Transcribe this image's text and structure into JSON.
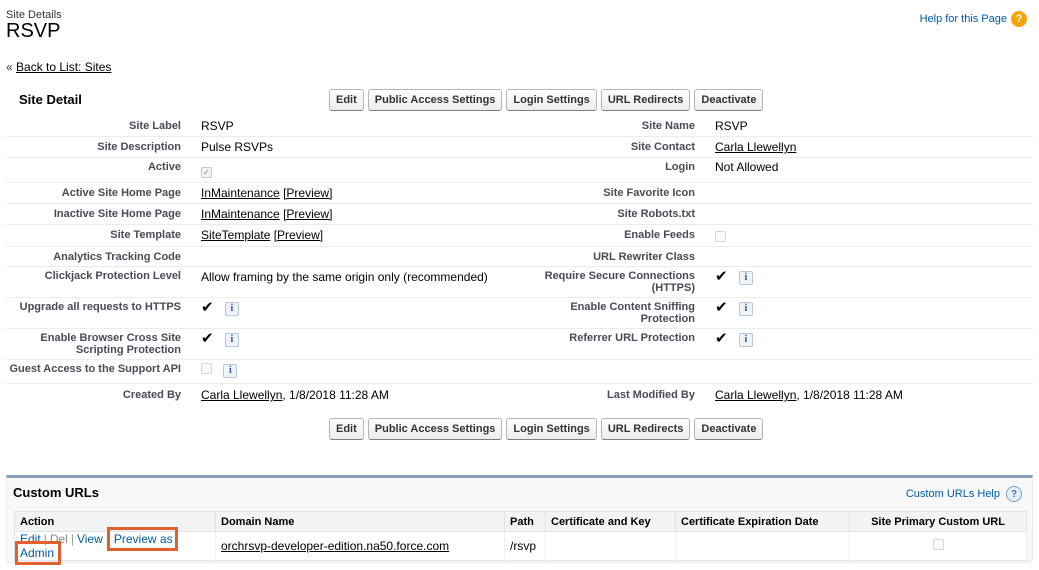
{
  "header": {
    "subtitle": "Site Details",
    "title": "RSVP",
    "help_label": "Help for this Page",
    "help_icon": "question-icon",
    "back_prefix": "«",
    "back_label": "Back to List: Sites"
  },
  "detail": {
    "section_title": "Site Detail",
    "buttons": [
      "Edit",
      "Public Access Settings",
      "Login Settings",
      "URL Redirects",
      "Deactivate"
    ],
    "rows": {
      "site_label": {
        "label": "Site Label",
        "value": "RSVP"
      },
      "site_name": {
        "label": "Site Name",
        "value": "RSVP"
      },
      "site_description": {
        "label": "Site Description",
        "value": "Pulse RSVPs"
      },
      "site_contact": {
        "label": "Site Contact",
        "value": "Carla Llewellyn"
      },
      "active": {
        "label": "Active",
        "checked": true
      },
      "login": {
        "label": "Login",
        "value": "Not Allowed"
      },
      "active_home": {
        "label": "Active Site Home Page",
        "value": "InMaintenance",
        "preview": "[Preview]"
      },
      "favorite_icon": {
        "label": "Site Favorite Icon"
      },
      "inactive_home": {
        "label": "Inactive Site Home Page",
        "value": "InMaintenance",
        "preview": "[Preview]"
      },
      "robots": {
        "label": "Site Robots.txt"
      },
      "template": {
        "label": "Site Template",
        "value": "SiteTemplate",
        "preview": "[Preview]"
      },
      "enable_feeds": {
        "label": "Enable Feeds",
        "checked": false
      },
      "analytics": {
        "label": "Analytics Tracking Code"
      },
      "url_rewriter": {
        "label": "URL Rewriter Class"
      },
      "clickjack": {
        "label": "Clickjack Protection Level",
        "value": "Allow framing by the same origin only (recommended)"
      },
      "secure_conn": {
        "label_line1": "Require Secure Connections",
        "label_line2": "(HTTPS)",
        "checked": true
      },
      "upgrade_https": {
        "label": "Upgrade all requests to HTTPS",
        "checked": true
      },
      "content_sniff": {
        "label_line1": "Enable Content Sniffing",
        "label_line2": "Protection",
        "checked": true
      },
      "xss": {
        "label_line1": "Enable Browser Cross Site",
        "label_line2": "Scripting Protection",
        "checked": true
      },
      "referrer": {
        "label": "Referrer URL Protection",
        "checked": true
      },
      "guest_access": {
        "label": "Guest Access to the Support API",
        "checked": false
      },
      "created_by": {
        "label": "Created By",
        "user": "Carla Llewellyn",
        "date": ", 1/8/2018 11:28 AM"
      },
      "modified_by": {
        "label": "Last Modified By",
        "user": "Carla Llewellyn",
        "date": ", 1/8/2018 11:28 AM"
      }
    },
    "info_glyph": "i",
    "check_glyph": "✔"
  },
  "custom_urls": {
    "title": "Custom URLs",
    "help_label": "Custom URLs Help",
    "help_icon": "question-icon",
    "columns": [
      "Action",
      "Domain Name",
      "Path",
      "Certificate and Key",
      "Certificate Expiration Date",
      "Site Primary Custom URL"
    ],
    "row": {
      "edit": "Edit",
      "del": "Del",
      "view": "View",
      "preview_admin": "Preview as Admin",
      "domain": "orchrsvp-developer-edition.na50.force.com",
      "path": "/rsvp",
      "certificate": "",
      "expiration": "",
      "primary": false
    },
    "highlight_color": "#e0612e"
  }
}
